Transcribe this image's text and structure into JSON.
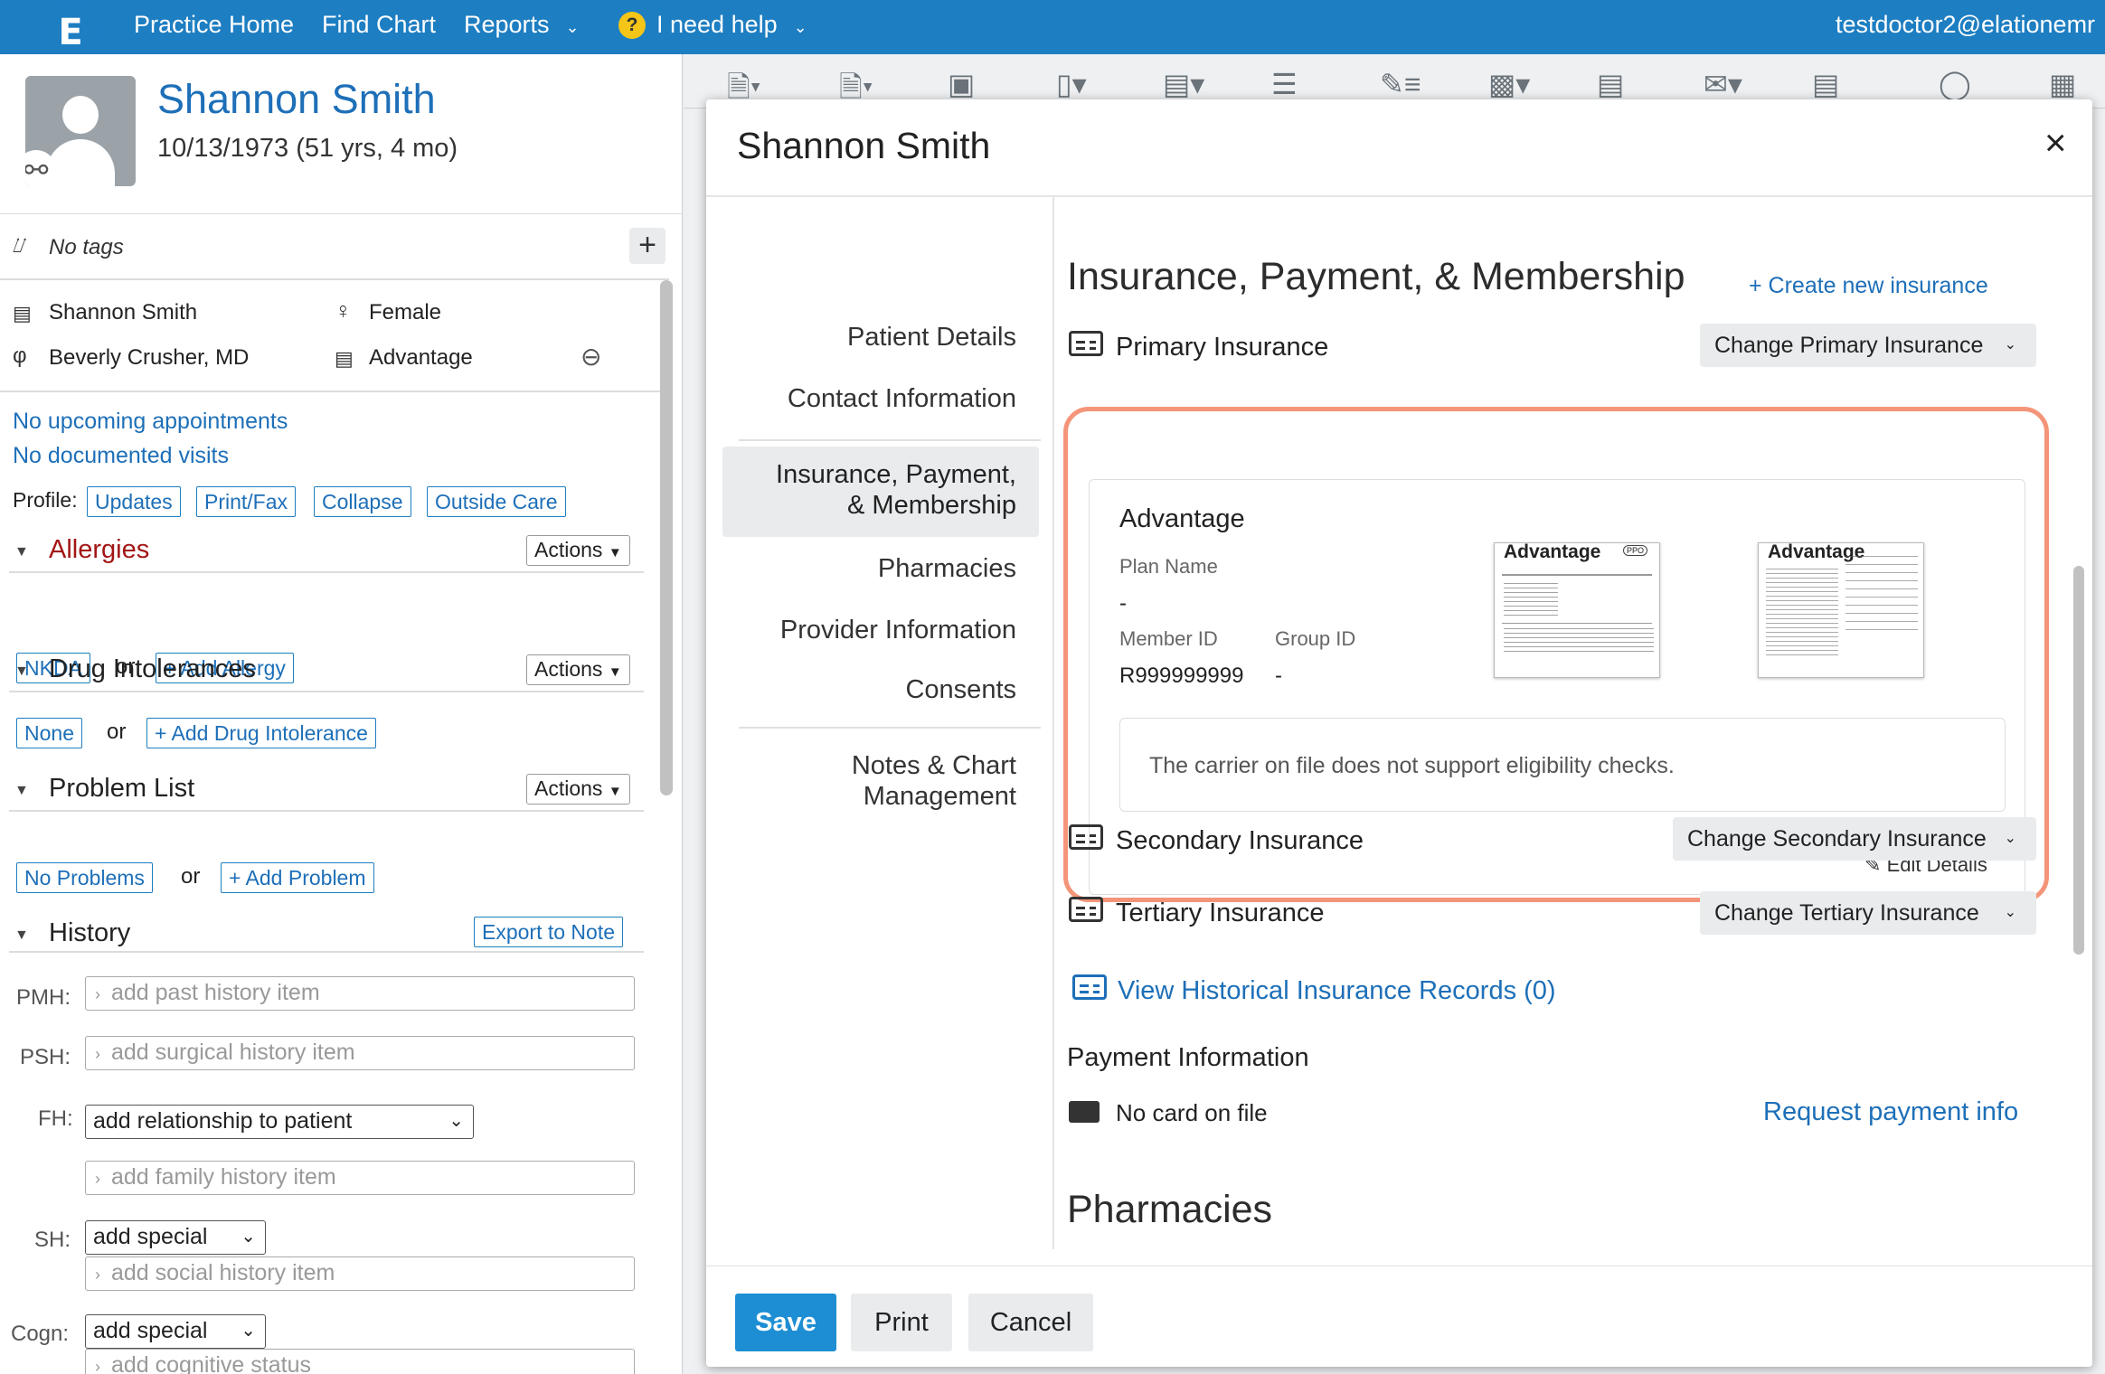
{
  "nav": {
    "logo": "E",
    "items": [
      "Practice Home",
      "Find Chart",
      "Reports"
    ],
    "help": "I need help",
    "help_icon": "?",
    "user": "testdoctor2@elationemr"
  },
  "patient": {
    "name": "Shannon Smith",
    "dob": "10/13/1973 (51 yrs, 4 mo)",
    "tags": "No tags",
    "fullname": "Shannon Smith",
    "sex": "Female",
    "provider": "Beverly Crusher, MD",
    "insurance": "Advantage",
    "appointments": "No upcoming appointments",
    "visits": "No documented visits",
    "profile_label": "Profile:",
    "profile_buttons": [
      "Updates",
      "Print/Fax",
      "Collapse",
      "Outside Care"
    ]
  },
  "sections": {
    "allergies": {
      "title": "Allergies",
      "actions": "Actions",
      "none": "NKDA",
      "or": "or",
      "add": "+ Add Allergy"
    },
    "drug": {
      "title": "Drug Intolerances",
      "actions": "Actions",
      "none": "None",
      "or": "or",
      "add": "+ Add Drug Intolerance"
    },
    "problems": {
      "title": "Problem List",
      "actions": "Actions",
      "none": "No Problems",
      "or": "or",
      "add": "+ Add Problem"
    },
    "history": {
      "title": "History",
      "export": "Export to Note",
      "pmh_label": "PMH:",
      "pmh_placeholder": "add past history item",
      "psh_label": "PSH:",
      "psh_placeholder": "add surgical history item",
      "fh_label": "FH:",
      "fh_select": "add relationship to patient",
      "fh_placeholder": "add family history item",
      "sh_label": "SH:",
      "sh_select": "add special",
      "sh_placeholder": "add social history item",
      "cogn_label": "Cogn:",
      "cogn_select": "add special",
      "cogn_placeholder": "add cognitive status"
    }
  },
  "modal": {
    "title": "Shannon Smith",
    "close": "×",
    "nav": [
      "Patient Details",
      "Contact Information",
      "Insurance, Payment,",
      "& Membership",
      "Pharmacies",
      "Provider Information",
      "Consents",
      "Notes & Chart",
      "Management"
    ],
    "section_title": "Insurance, Payment, & Membership",
    "create_insurance": "+ Create new insurance",
    "primary": {
      "label": "Primary Insurance",
      "change": "Change Primary Insurance",
      "carrier": "Advantage",
      "plan_label": "Plan Name",
      "plan_value": "-",
      "member_label": "Member ID",
      "member_value": "R999999999",
      "group_label": "Group ID",
      "group_value": "-",
      "eligibility": "The carrier on file does not support eligibility checks.",
      "edit": "Edit Details",
      "card_front_title": "Advantage",
      "card_back_title": "Advantage",
      "card_ppo": "PPO"
    },
    "secondary": {
      "label": "Secondary Insurance",
      "change": "Change Secondary Insurance"
    },
    "tertiary": {
      "label": "Tertiary Insurance",
      "change": "Change Tertiary Insurance"
    },
    "historical": "View Historical Insurance Records (0)",
    "payment_title": "Payment Information",
    "no_card": "No card on file",
    "request_payment": "Request payment info",
    "pharmacies_title": "Pharmacies",
    "buttons": {
      "save": "Save",
      "print": "Print",
      "cancel": "Cancel"
    }
  },
  "colors": {
    "brand": "#1d7ec2",
    "link": "#1d6fb8",
    "highlight": "#f4957a",
    "allergy_red": "#a31515"
  }
}
